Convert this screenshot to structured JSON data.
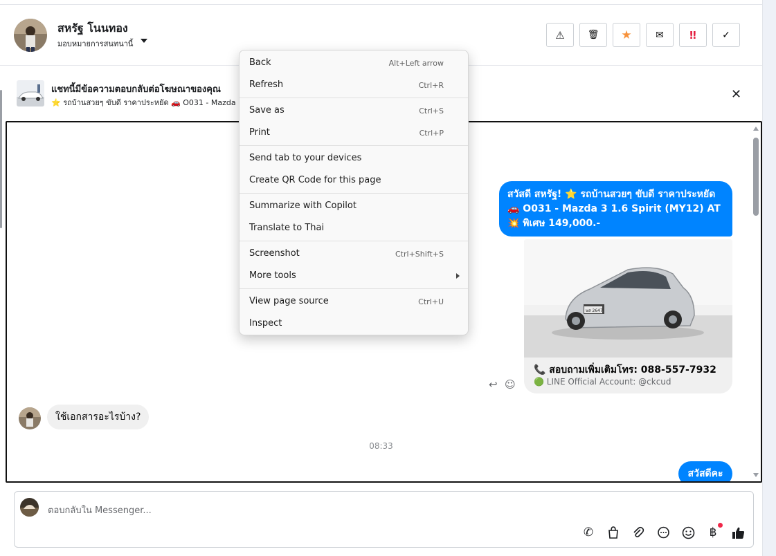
{
  "header": {
    "name": "สหรัฐ โนนทอง",
    "assign_label": "มอบหมายการสนทนานี้",
    "toolbar": [
      "⚠",
      "🗑",
      "★",
      "✉",
      "‼",
      "✓"
    ]
  },
  "banner": {
    "title": "แชทนี้มีข้อความตอบกลับต่อโฆษณาของคุณ",
    "subtitle": "⭐ รถบ้านสวยๆ ขับดี ราคาประหยัด 🚗 O031 - Mazda",
    "close": "✕"
  },
  "chat": {
    "outgoing_1": {
      "line1": "สวัสดี สหรัฐ! ⭐ รถบ้านสวยๆ ขับดี ราคาประหยัด",
      "line2": "🚗 O031 - Mazda 3 1.6 Spirit (MY12) AT",
      "line3": "💥 พิเศษ 149,000.-"
    },
    "card": {
      "phone_line": "📞 สอบถามเพิ่มเติมโทร: 088-557-7932",
      "line_account": "🟢 LINE Official Account: @ckcud",
      "plate": "ษส 2647"
    },
    "incoming_1": "ใช้เอกสารอะไรบ้าง?",
    "time": "08:33",
    "outgoing_2": "สวัสดีคะ"
  },
  "composer": {
    "placeholder": "ตอบกลับใน Messenger..."
  },
  "context_menu": {
    "items": [
      {
        "label": "Back",
        "shortcut": "Alt+Left arrow"
      },
      {
        "label": "Refresh",
        "shortcut": "Ctrl+R"
      },
      {
        "label": "Save as",
        "shortcut": "Ctrl+S"
      },
      {
        "label": "Print",
        "shortcut": "Ctrl+P"
      },
      {
        "label": "Send tab to your devices",
        "shortcut": ""
      },
      {
        "label": "Create QR Code for this page",
        "shortcut": ""
      },
      {
        "label": "Summarize with Copilot",
        "shortcut": ""
      },
      {
        "label": "Translate to Thai",
        "shortcut": ""
      },
      {
        "label": "Screenshot",
        "shortcut": "Ctrl+Shift+S"
      },
      {
        "label": "More tools",
        "shortcut": ""
      },
      {
        "label": "View page source",
        "shortcut": "Ctrl+U"
      },
      {
        "label": "Inspect",
        "shortcut": ""
      }
    ]
  },
  "colors": {
    "brand_blue": "#0084ff",
    "star_orange": "#f7923b",
    "alert_red": "#e41e3f"
  }
}
